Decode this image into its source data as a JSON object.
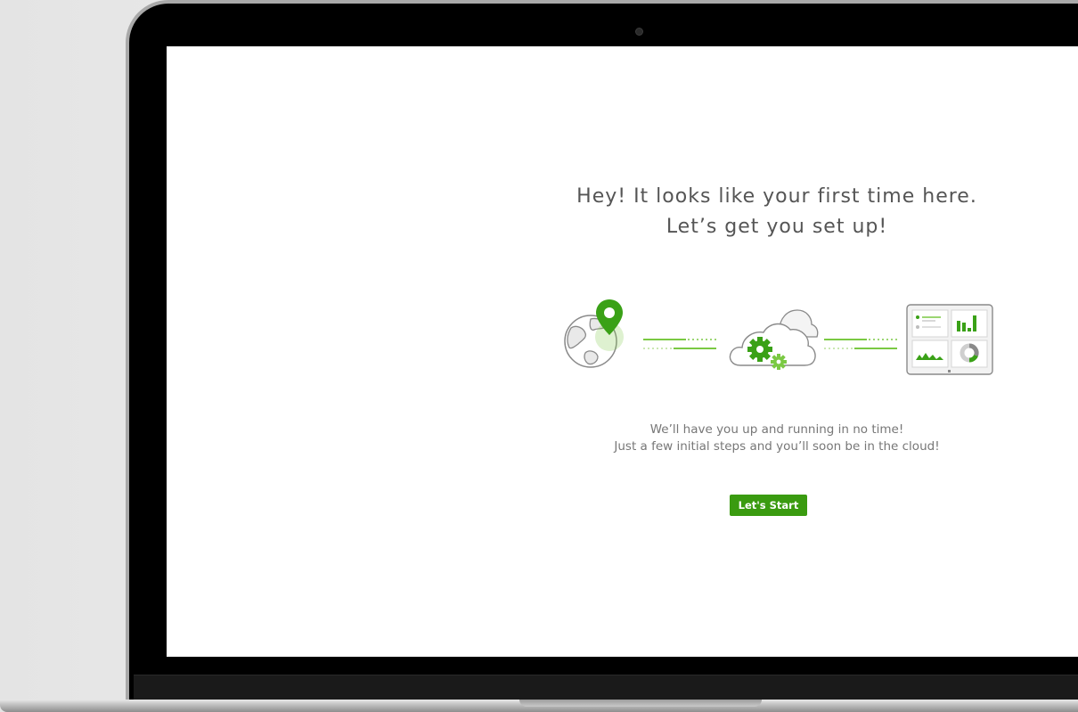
{
  "welcome": {
    "heading_line1": "Hey! It looks like your first time here.",
    "heading_line2": "Let’s get you set up!",
    "subtext_line1": "We’ll have you up and running in no time!",
    "subtext_line2": "Just a few initial steps and you’ll soon be in the cloud!",
    "start_button_label": "Let's Start"
  },
  "illustration": {
    "icons": [
      "globe-location-icon",
      "cloud-gears-icon",
      "dashboard-tablet-icon"
    ]
  },
  "colors": {
    "accent": "#7ac943",
    "button": "#3a9b10",
    "text": "#555555"
  }
}
